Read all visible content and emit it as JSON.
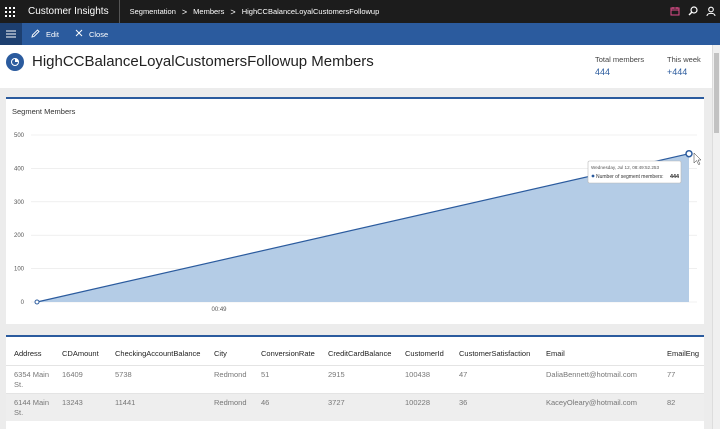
{
  "app": {
    "title": "Customer Insights",
    "breadcrumb": [
      "Segmentation",
      "Members",
      "HighCCBalanceLoyalCustomersFollowup"
    ],
    "separator": ">"
  },
  "commands": {
    "edit": "Edit",
    "close": "Close"
  },
  "page": {
    "title": "HighCCBalanceLoyalCustomersFollowup Members",
    "stats": [
      {
        "label": "Total members",
        "value": "444"
      },
      {
        "label": "This week",
        "value": "+444"
      }
    ]
  },
  "chart_card": {
    "title": "Segment Members"
  },
  "chart_data": {
    "type": "area",
    "x": [
      "",
      "00:49",
      "Wednesday, Jul 12, 08:49:52.253"
    ],
    "y_ticks": [
      "0",
      "100",
      "200",
      "300",
      "400",
      "500"
    ],
    "ylim": [
      0,
      500
    ],
    "x_tick_label": "00:49",
    "points": [
      {
        "x": 0,
        "y": 0
      },
      {
        "x": 1,
        "y": 444
      }
    ],
    "color": "#2b5b9e",
    "fill": "#b4cce6",
    "grid": true,
    "tooltip": {
      "timestamp": "Wednesday, Jul 12, 08:49:52.253",
      "series": "Number of segment members:",
      "value": "444"
    }
  },
  "table": {
    "columns": [
      "Address",
      "CDAmount",
      "CheckingAccountBalance",
      "City",
      "ConversionRate",
      "CreditCardBalance",
      "CustomerId",
      "CustomerSatisfaction",
      "Email",
      "EmailEng"
    ],
    "rows": [
      [
        "6354 Main St.",
        "16409",
        "5738",
        "Redmond",
        "51",
        "2915",
        "100438",
        "47",
        "DaliaBennett@hotmail.com",
        "77"
      ],
      [
        "6144 Main St.",
        "13243",
        "11441",
        "Redmond",
        "46",
        "3727",
        "100228",
        "36",
        "KaceyOleary@hotmail.com",
        "82"
      ]
    ]
  }
}
